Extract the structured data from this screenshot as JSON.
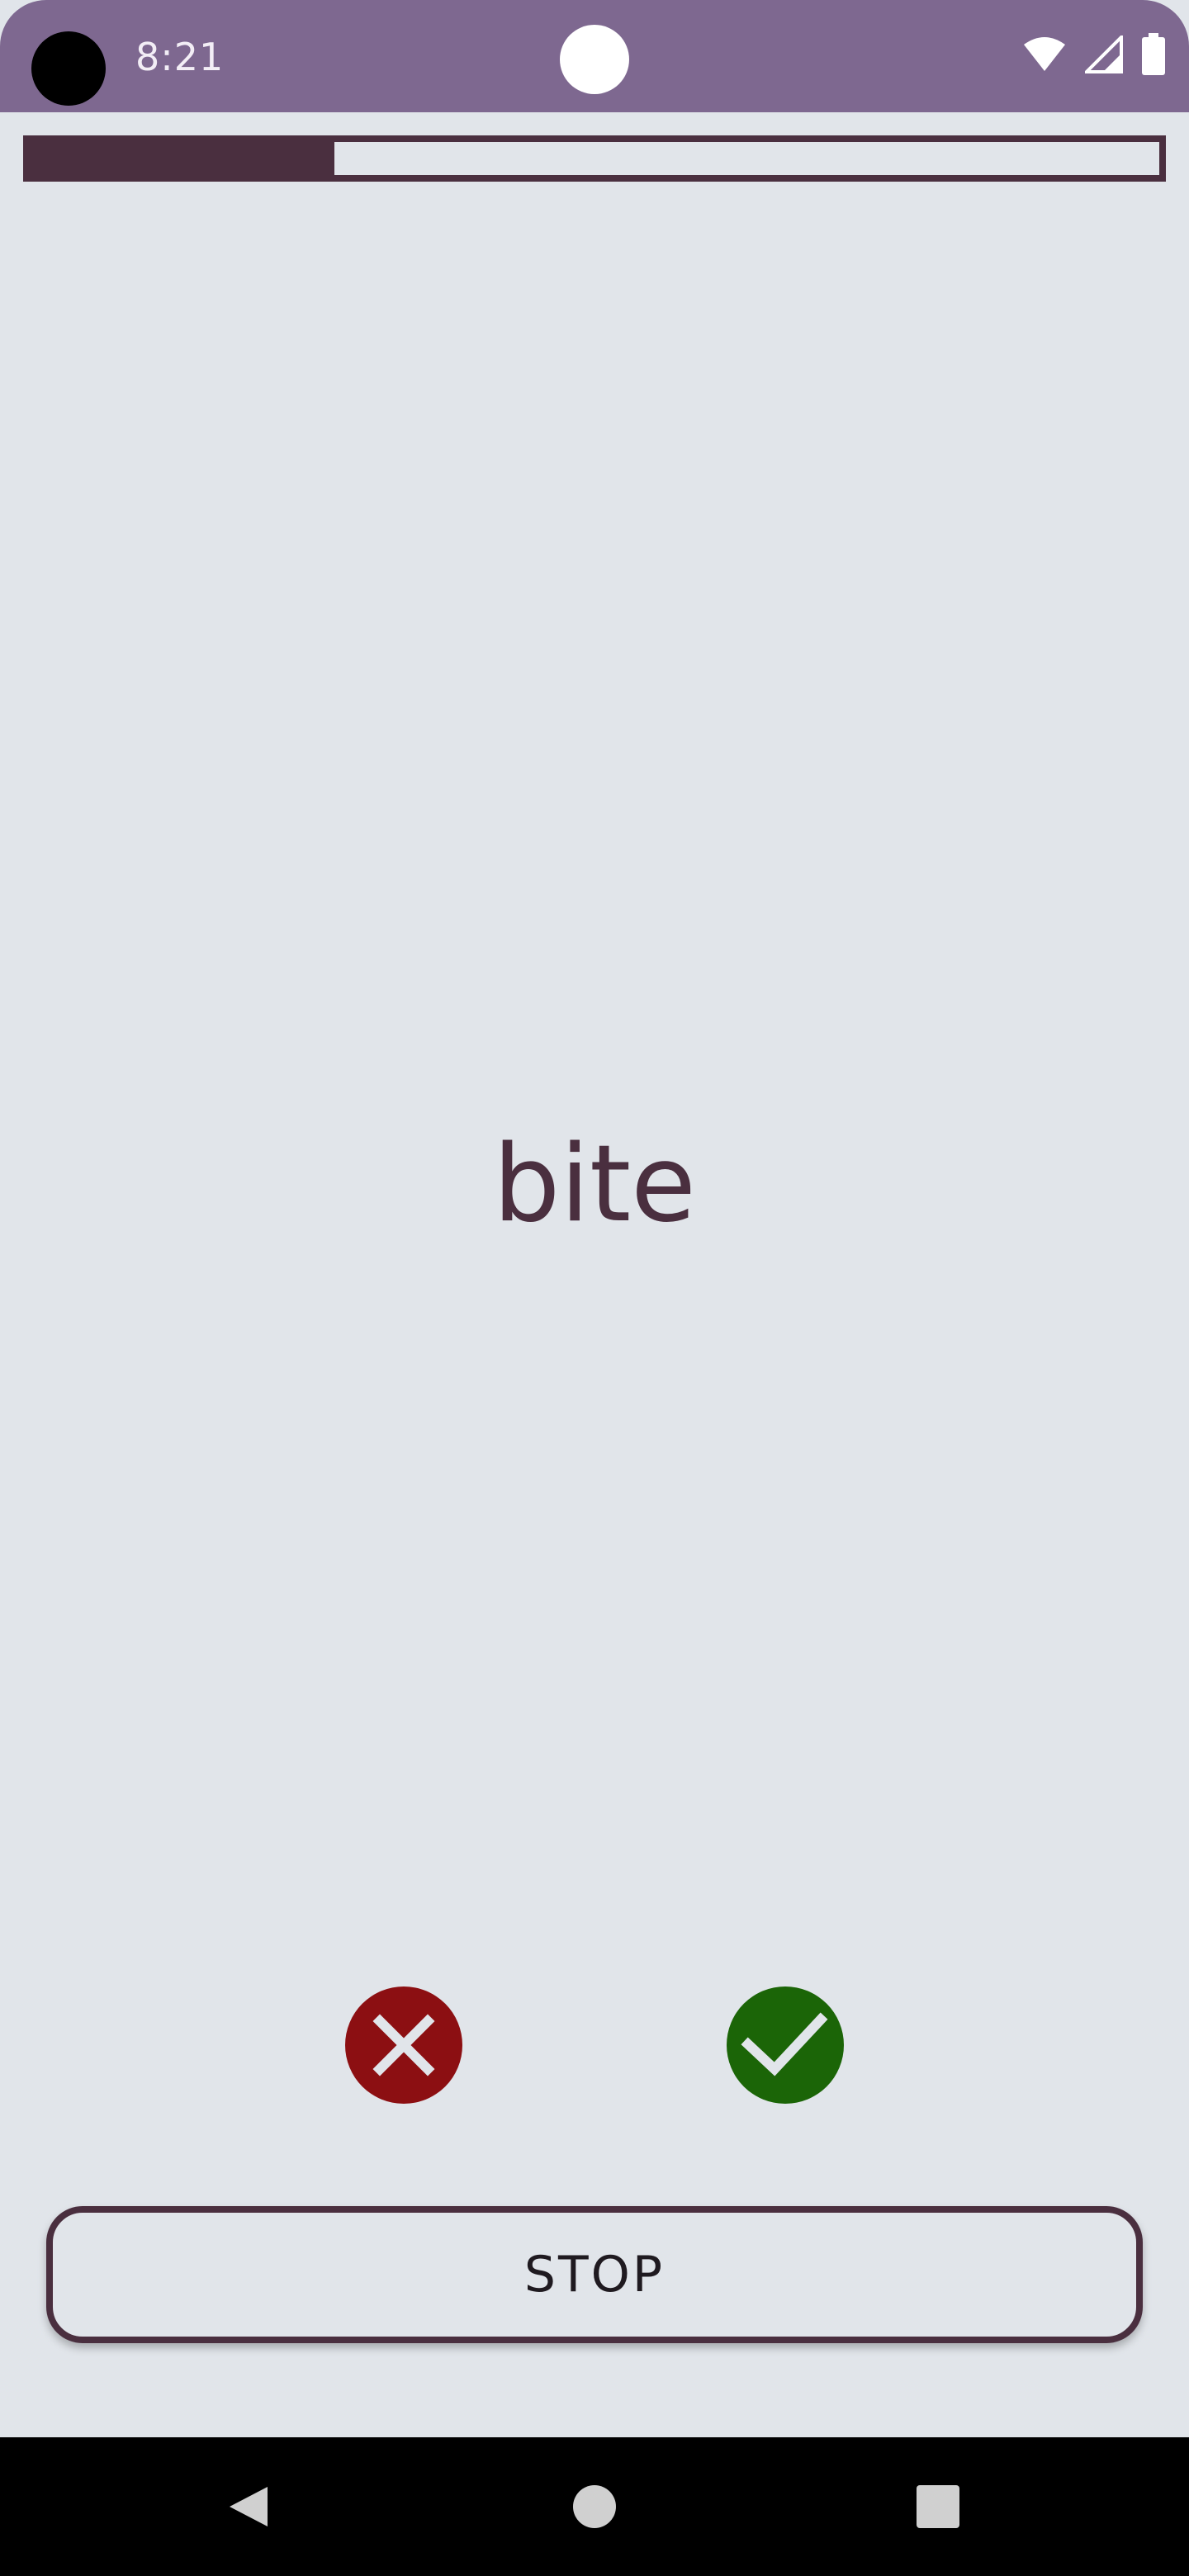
{
  "status_bar": {
    "time": "8:21",
    "icons": [
      "camera-hole",
      "notification-dot",
      "wifi-icon",
      "signal-icon",
      "battery-icon"
    ]
  },
  "progress": {
    "value": 0.27
  },
  "card": {
    "word": "bite"
  },
  "answers": {
    "wrong_icon": "close-icon",
    "right_icon": "check-icon"
  },
  "stop_button": {
    "label": "STOP"
  },
  "navigation": {
    "icons": [
      "back-icon",
      "home-icon",
      "recents-icon"
    ]
  },
  "colors": {
    "status_bar": "#7e6890",
    "background": "#e1e5ea",
    "accent": "#4a2f3f",
    "wrong": "#8c0f12",
    "right": "#1b6507"
  }
}
